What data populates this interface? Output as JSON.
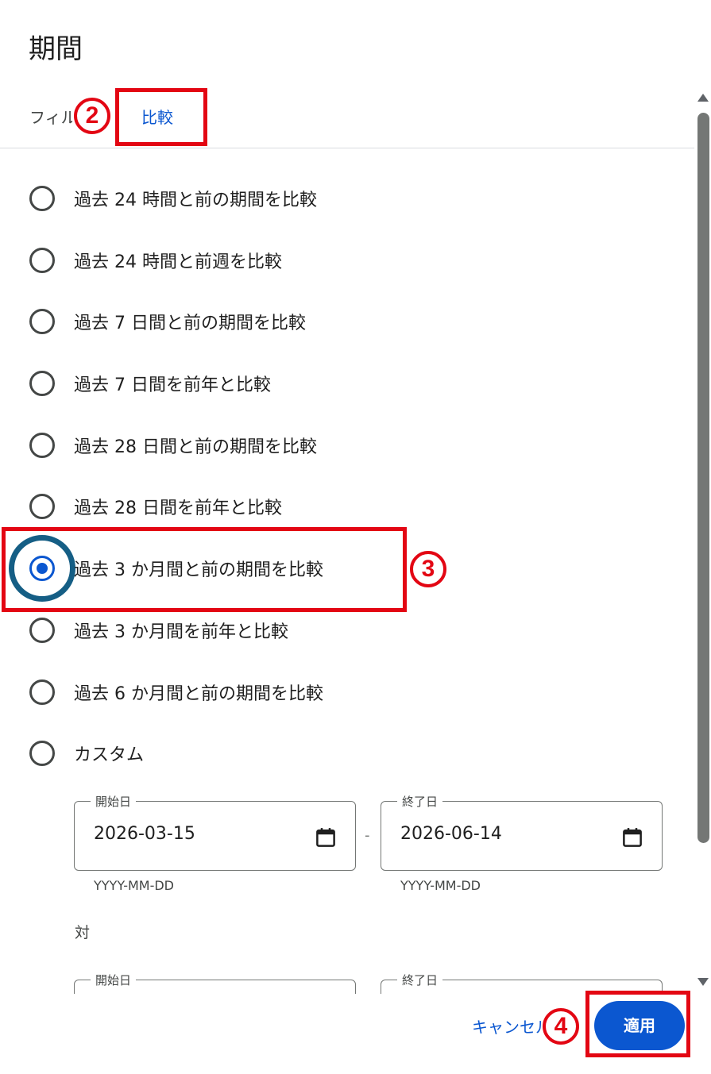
{
  "dialog": {
    "title": "期間",
    "tabs": {
      "filter_label": "フィルタ",
      "compare_label": "比較"
    },
    "options": [
      {
        "label": "過去 24 時間と前の期間を比較",
        "checked": false
      },
      {
        "label": "過去 24 時間と前週を比較",
        "checked": false
      },
      {
        "label": "過去 7 日間と前の期間を比較",
        "checked": false
      },
      {
        "label": "過去 7 日間を前年と比較",
        "checked": false
      },
      {
        "label": "過去 28 日間と前の期間を比較",
        "checked": false
      },
      {
        "label": "過去 28 日間を前年と比較",
        "checked": false
      },
      {
        "label": "過去 3 か月間と前の期間を比較",
        "checked": true
      },
      {
        "label": "過去 3 か月間を前年と比較",
        "checked": false
      },
      {
        "label": "過去 6 か月間と前の期間を比較",
        "checked": false
      },
      {
        "label": "カスタム",
        "checked": false
      }
    ],
    "custom": {
      "start_label": "開始日",
      "start_value": "2026-03-15",
      "end_label": "終了日",
      "end_value": "2026-06-14",
      "format_hint": "YYYY-MM-DD",
      "separator": "-",
      "versus_label": "対",
      "compare_start_label": "開始日",
      "compare_end_label": "終了日"
    },
    "footer": {
      "cancel_label": "キャンセル",
      "apply_label": "適用"
    }
  },
  "annotations": {
    "step2": "2",
    "step3": "3",
    "step4": "4",
    "highlight_color": "#e30613"
  },
  "colors": {
    "accent": "#0b57d0",
    "text": "#1f1f1f"
  }
}
